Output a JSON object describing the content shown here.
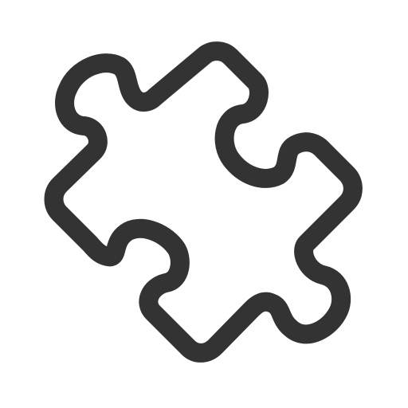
{
  "icon": {
    "name": "puzzle-piece-icon",
    "stroke_color": "#333333",
    "background_color": "#ffffff"
  }
}
